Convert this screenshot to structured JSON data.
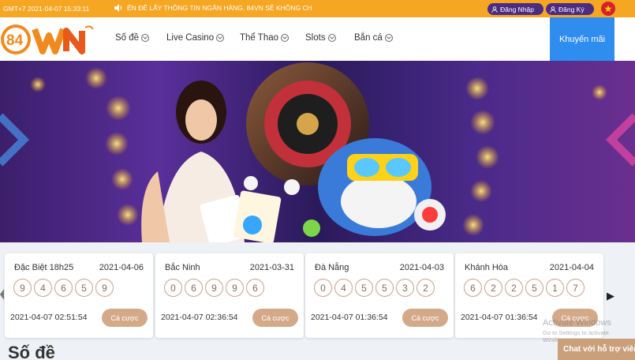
{
  "topbar": {
    "time": "GMT+7 2021-04-07 15:33:11",
    "marquee": "ỂN ĐỂ LẤY THÔNG TIN NGÂN HÀNG, 84VN SẼ KHÔNG CH",
    "login_label": "Đăng Nhập",
    "register_label": "Đăng Ký"
  },
  "nav": {
    "items": [
      {
        "label": "Số đề"
      },
      {
        "label": "Live Casino"
      },
      {
        "label": "Thể Thao"
      },
      {
        "label": "Slots"
      },
      {
        "label": "Bắn cá"
      }
    ],
    "promo_label": "Khuyến mãi"
  },
  "results": [
    {
      "name": "Đặc Biệt 18h25",
      "date": "2021-04-06",
      "numbers": [
        "9",
        "4",
        "6",
        "5",
        "9"
      ],
      "time": "2021-04-07 02:51:54",
      "bet_label": "Cá cược"
    },
    {
      "name": "Bắc Ninh",
      "date": "2021-03-31",
      "numbers": [
        "0",
        "6",
        "9",
        "9",
        "6"
      ],
      "time": "2021-04-07 02:36:54",
      "bet_label": "Cá cược"
    },
    {
      "name": "Đà Nẵng",
      "date": "2021-04-03",
      "numbers": [
        "0",
        "4",
        "5",
        "5",
        "3",
        "2"
      ],
      "time": "2021-04-07 01:36:54",
      "bet_label": "Cá cược"
    },
    {
      "name": "Khánh Hòa",
      "date": "2021-04-04",
      "numbers": [
        "6",
        "2",
        "2",
        "5",
        "1",
        "7"
      ],
      "time": "2021-04-07 01:36:54",
      "bet_label": "Cá cược"
    }
  ],
  "section_title": "Số đề",
  "chat_label": "Chat với hỗ trợ viên",
  "watermark": {
    "title": "Activate Windows",
    "sub": "Go to Settings to activate Windows."
  },
  "colors": {
    "topbar": "#f5a623",
    "promo": "#2f8df0",
    "account_btn": "#4b2c82",
    "bet_btn": "#d4a98a",
    "chat": "#c9a07a"
  }
}
